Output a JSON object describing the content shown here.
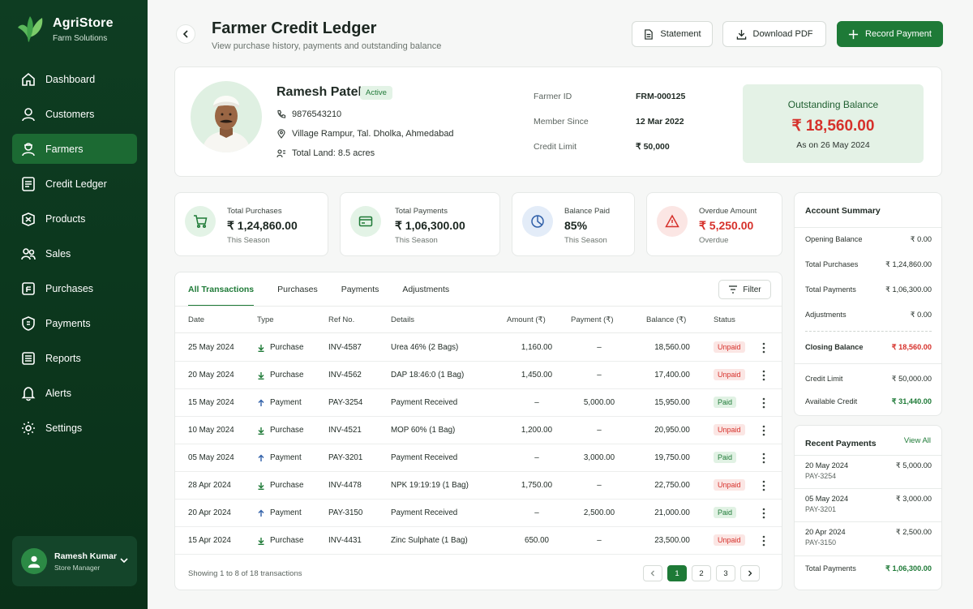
{
  "brand": {
    "name": "AgriStore",
    "subtitle": "Farm Solutions"
  },
  "sidebar": {
    "items": [
      {
        "label": "Dashboard",
        "icon": "home-icon"
      },
      {
        "label": "Customers",
        "icon": "user-icon"
      },
      {
        "label": "Farmers",
        "icon": "farmer-icon",
        "active": true
      },
      {
        "label": "Credit Ledger",
        "icon": "ledger-icon"
      },
      {
        "label": "Products",
        "icon": "box-icon"
      },
      {
        "label": "Sales",
        "icon": "users-icon"
      },
      {
        "label": "Purchases",
        "icon": "purchase-icon"
      },
      {
        "label": "Payments",
        "icon": "payment-icon"
      },
      {
        "label": "Reports",
        "icon": "report-icon"
      },
      {
        "label": "Alerts",
        "icon": "bell-icon"
      },
      {
        "label": "Settings",
        "icon": "gear-icon"
      }
    ],
    "user": {
      "name": "Ramesh Kumar",
      "role": "Store Manager"
    }
  },
  "header": {
    "title": "Farmer Credit Ledger",
    "subtitle": "View purchase history, payments and outstanding balance",
    "buttons": {
      "statement": "Statement",
      "download": "Download PDF",
      "record": "Record Payment"
    }
  },
  "profile": {
    "name": "Ramesh Patel",
    "status": "Active",
    "phone": "9876543210",
    "address": "Village Rampur, Tal. Dholka, Ahmedabad",
    "land": "Total Land: 8.5 acres",
    "meta": [
      {
        "label": "Farmer ID",
        "value": "FRM-000125"
      },
      {
        "label": "Member Since",
        "value": "12 Mar 2022"
      },
      {
        "label": "Credit Limit",
        "value": "₹ 50,000"
      }
    ],
    "outstanding": {
      "label": "Outstanding Balance",
      "value": "₹ 18,560.00",
      "as_of": "As on 26 May 2024"
    }
  },
  "stats": [
    {
      "label": "Total Purchases",
      "value": "₹ 1,24,860.00",
      "sub": "This Season",
      "icon": "cart-icon"
    },
    {
      "label": "Total Payments",
      "value": "₹ 1,06,300.00",
      "sub": "This Season",
      "icon": "card-icon"
    },
    {
      "label": "Balance Paid",
      "value": "85%",
      "sub": "This Season",
      "icon": "pie-icon"
    },
    {
      "label": "Overdue Amount",
      "value": "₹ 5,250.00",
      "sub": "Overdue",
      "icon": "warning-icon"
    }
  ],
  "transactions": {
    "tabs": [
      "All Transactions",
      "Purchases",
      "Payments",
      "Adjustments"
    ],
    "filter_label": "Filter",
    "columns": [
      "Date",
      "Type",
      "Ref No.",
      "Details",
      "Amount (₹)",
      "Payment (₹)",
      "Balance (₹)",
      "Status"
    ],
    "rows": [
      {
        "date": "25 May 2024",
        "type": "Purchase",
        "ref": "INV-4587",
        "details": "Urea 46% (2 Bags)",
        "amount": "1,160.00",
        "payment": "–",
        "balance": "18,560.00",
        "status": "Unpaid"
      },
      {
        "date": "20 May 2024",
        "type": "Purchase",
        "ref": "INV-4562",
        "details": "DAP 18:46:0 (1 Bag)",
        "amount": "1,450.00",
        "payment": "–",
        "balance": "17,400.00",
        "status": "Unpaid"
      },
      {
        "date": "15 May 2024",
        "type": "Payment",
        "ref": "PAY-3254",
        "details": "Payment Received",
        "amount": "–",
        "payment": "5,000.00",
        "balance": "15,950.00",
        "status": "Paid"
      },
      {
        "date": "10 May 2024",
        "type": "Purchase",
        "ref": "INV-4521",
        "details": "MOP 60% (1 Bag)",
        "amount": "1,200.00",
        "payment": "–",
        "balance": "20,950.00",
        "status": "Unpaid"
      },
      {
        "date": "05 May 2024",
        "type": "Payment",
        "ref": "PAY-3201",
        "details": "Payment Received",
        "amount": "–",
        "payment": "3,000.00",
        "balance": "19,750.00",
        "status": "Paid"
      },
      {
        "date": "28 Apr 2024",
        "type": "Purchase",
        "ref": "INV-4478",
        "details": "NPK 19:19:19 (1 Bag)",
        "amount": "1,750.00",
        "payment": "–",
        "balance": "22,750.00",
        "status": "Unpaid"
      },
      {
        "date": "20 Apr 2024",
        "type": "Payment",
        "ref": "PAY-3150",
        "details": "Payment Received",
        "amount": "–",
        "payment": "2,500.00",
        "balance": "21,000.00",
        "status": "Paid"
      },
      {
        "date": "15 Apr 2024",
        "type": "Purchase",
        "ref": "INV-4431",
        "details": "Zinc Sulphate (1 Bag)",
        "amount": "650.00",
        "payment": "–",
        "balance": "23,500.00",
        "status": "Unpaid"
      }
    ],
    "showing": "Showing 1 to 8 of 18 transactions",
    "pages": [
      "1",
      "2",
      "3"
    ],
    "current_page": "1"
  },
  "summary": {
    "title": "Account Summary",
    "rows": [
      {
        "label": "Opening Balance",
        "value": "₹ 0.00"
      },
      {
        "label": "Total Purchases",
        "value": "₹ 1,24,860.00"
      },
      {
        "label": "Total Payments",
        "value": "₹ 1,06,300.00"
      },
      {
        "label": "Adjustments",
        "value": "₹ 0.00"
      }
    ],
    "closing": {
      "label": "Closing Balance",
      "value": "₹ 18,560.00"
    },
    "credit_limit": {
      "label": "Credit Limit",
      "value": "₹ 50,000.00"
    },
    "available": {
      "label": "Available Credit",
      "value": "₹ 31,440.00"
    }
  },
  "recent": {
    "title": "Recent Payments",
    "view_all": "View All",
    "items": [
      {
        "date": "20 May 2024",
        "ref": "PAY-3254",
        "amount": "₹ 5,000.00"
      },
      {
        "date": "05 May 2024",
        "ref": "PAY-3201",
        "amount": "₹ 3,000.00"
      },
      {
        "date": "20 Apr 2024",
        "ref": "PAY-3150",
        "amount": "₹ 2,500.00"
      }
    ],
    "total": {
      "label": "Total Payments",
      "value": "₹ 1,06,300.00"
    }
  },
  "colors": {
    "primary": "#1e7a37",
    "sidebar": "#0e3d22",
    "danger": "#d6312b",
    "paid_bg": "#e1f2e4",
    "unpaid_bg": "#fbe6e4"
  }
}
